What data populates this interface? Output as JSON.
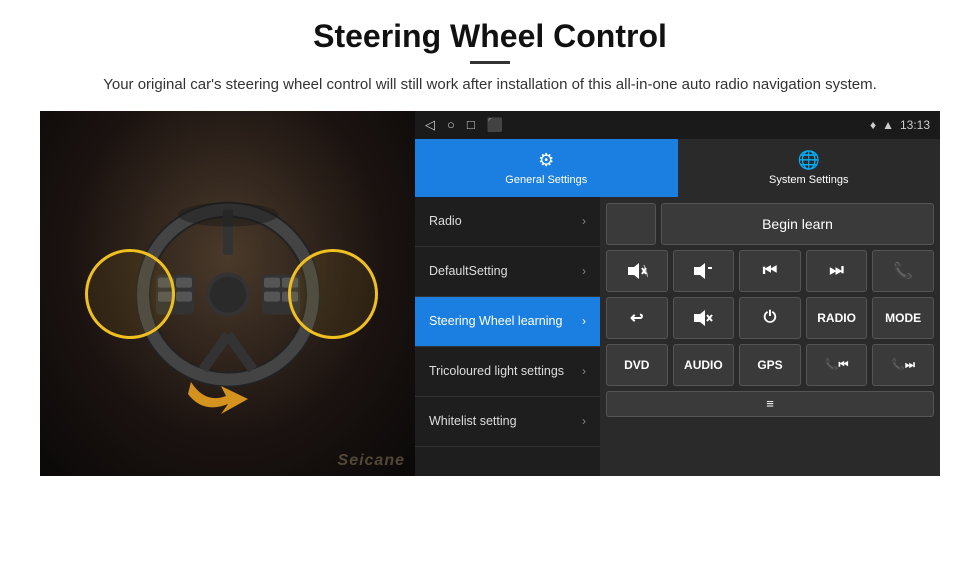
{
  "header": {
    "title": "Steering Wheel Control",
    "subtitle": "Your original car's steering wheel control will still work after installation of this all-in-one auto radio navigation system."
  },
  "status_bar": {
    "time": "13:13",
    "icons": [
      "◁",
      "○",
      "□",
      "⬜"
    ]
  },
  "tabs": [
    {
      "id": "general",
      "label": "General Settings",
      "active": true
    },
    {
      "id": "system",
      "label": "System Settings",
      "active": false
    }
  ],
  "menu": {
    "items": [
      {
        "id": "radio",
        "label": "Radio",
        "active": false
      },
      {
        "id": "default",
        "label": "DefaultSetting",
        "active": false
      },
      {
        "id": "steering",
        "label": "Steering Wheel learning",
        "active": true
      },
      {
        "id": "tricoloured",
        "label": "Tricoloured light settings",
        "active": false
      },
      {
        "id": "whitelist",
        "label": "Whitelist setting",
        "active": false
      }
    ]
  },
  "control_panel": {
    "begin_learn_label": "Begin learn",
    "buttons_row1": [
      "🔊+",
      "🔊−",
      "⏮",
      "⏭",
      "📞"
    ],
    "buttons_row2": [
      "↩",
      "🔇",
      "⏻",
      "RADIO",
      "MODE"
    ],
    "buttons_row3": [
      "DVD",
      "AUDIO",
      "GPS",
      "📞⏮",
      "📞⏭"
    ]
  }
}
